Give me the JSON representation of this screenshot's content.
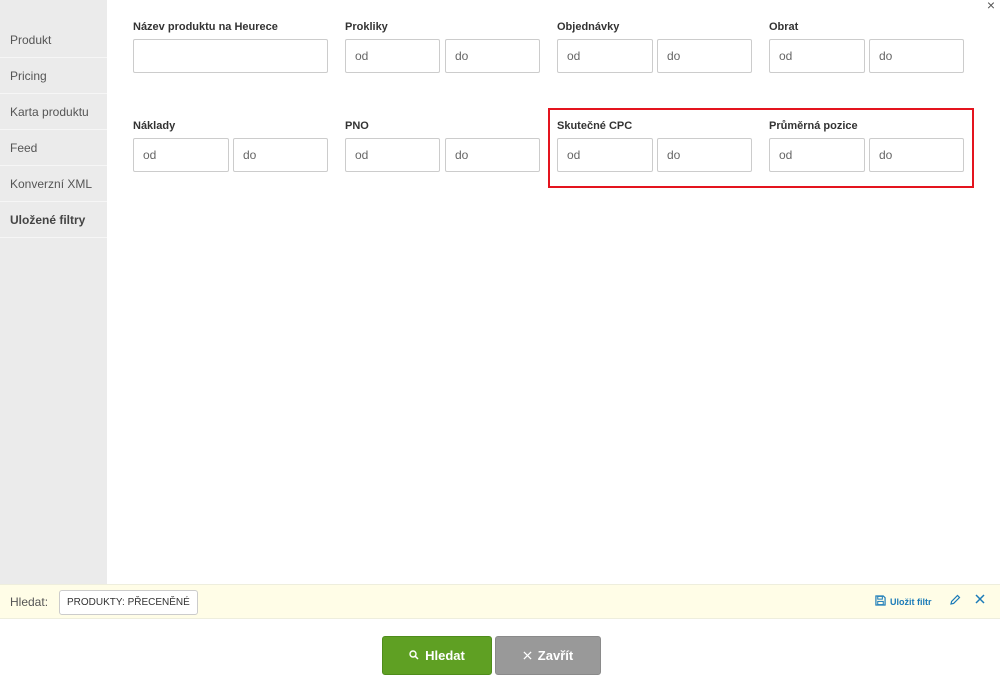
{
  "sidebar": {
    "items": [
      {
        "label": "Produkt"
      },
      {
        "label": "Pricing"
      },
      {
        "label": "Karta produktu"
      },
      {
        "label": "Feed"
      },
      {
        "label": "Konverzní XML"
      },
      {
        "label": "Uložené filtry"
      }
    ]
  },
  "close_icon": "×",
  "fields": {
    "nazev": {
      "label": "Název produktu na Heurece",
      "value": ""
    },
    "prokliky": {
      "label": "Prokliky",
      "from": "od",
      "to": "do"
    },
    "objednavky": {
      "label": "Objednávky",
      "from": "od",
      "to": "do"
    },
    "obrat": {
      "label": "Obrat",
      "from": "od",
      "to": "do"
    },
    "naklady": {
      "label": "Náklady",
      "from": "od",
      "to": "do"
    },
    "pno": {
      "label": "PNO",
      "from": "od",
      "to": "do"
    },
    "cpc": {
      "label": "Skutečné CPC",
      "from": "od",
      "to": "do"
    },
    "pozice": {
      "label": "Průměrná pozice",
      "from": "od",
      "to": "do"
    }
  },
  "footer": {
    "search_label": "Hledat:",
    "tag": "PRODUKTY: PŘECENĚNÉ",
    "save_filter": "Uložit filtr"
  },
  "buttons": {
    "search": "Hledat",
    "close": "Zavřít"
  },
  "colors": {
    "accent_green": "#5fa023",
    "link_blue": "#1b7bb8",
    "highlight_red": "#e4141e"
  }
}
